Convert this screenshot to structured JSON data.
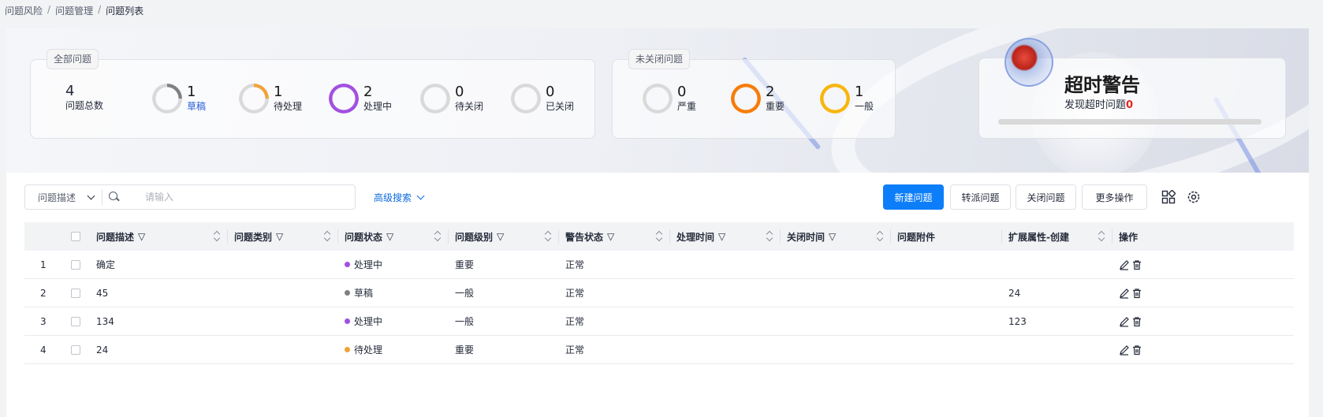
{
  "breadcrumb": [
    "问题风险",
    "问题管理",
    "问题列表"
  ],
  "all_issues": {
    "tag": "全部问题",
    "total": {
      "value": "4",
      "label": "问题总数"
    },
    "stats": [
      {
        "value": "1",
        "label": "草稿",
        "color": "#808080",
        "fraction": 0.25
      },
      {
        "value": "1",
        "label": "待处理",
        "color": "#f2a13a",
        "fraction": 0.25
      },
      {
        "value": "2",
        "label": "处理中",
        "color": "#a14fe0",
        "fraction": 1
      },
      {
        "value": "0",
        "label": "待关闭",
        "color": "#d9d9d9",
        "fraction": 0
      },
      {
        "value": "0",
        "label": "已关闭",
        "color": "#d9d9d9",
        "fraction": 0
      }
    ]
  },
  "open_issues": {
    "tag": "未关闭问题",
    "stats": [
      {
        "value": "0",
        "label": "严重",
        "color": "#d9d9d9",
        "fraction": 0
      },
      {
        "value": "2",
        "label": "重要",
        "color": "#f77b08",
        "fraction": 1
      },
      {
        "value": "1",
        "label": "一般",
        "color": "#f7b60e",
        "fraction": 1
      }
    ]
  },
  "alert": {
    "title": "超时警告",
    "sub_label": "发现超时问题",
    "count": "0"
  },
  "search": {
    "field": "问题描述",
    "placeholder": "请输入",
    "advanced": "高级搜索"
  },
  "buttons": {
    "new": "新建问题",
    "transfer": "转派问题",
    "close": "关闭问题",
    "more": "更多操作"
  },
  "table": {
    "columns": [
      "问题描述",
      "问题类别",
      "问题状态",
      "问题级别",
      "警告状态",
      "处理时间",
      "关闭时间",
      "问题附件",
      "扩展属性-创建",
      "操作"
    ],
    "rows": [
      {
        "index": "1",
        "desc": "确定",
        "category": "",
        "status": "处理中",
        "status_color": "#a14fe0",
        "level": "重要",
        "warn": "正常",
        "handle_time": "",
        "close_time": "",
        "attach": "",
        "ext": ""
      },
      {
        "index": "2",
        "desc": "45",
        "category": "",
        "status": "草稿",
        "status_color": "#808080",
        "level": "一般",
        "warn": "正常",
        "handle_time": "",
        "close_time": "",
        "attach": "",
        "ext": "24"
      },
      {
        "index": "3",
        "desc": "134",
        "category": "",
        "status": "处理中",
        "status_color": "#a14fe0",
        "level": "一般",
        "warn": "正常",
        "handle_time": "",
        "close_time": "",
        "attach": "",
        "ext": "123"
      },
      {
        "index": "4",
        "desc": "24",
        "category": "",
        "status": "待处理",
        "status_color": "#f2a13a",
        "level": "重要",
        "warn": "正常",
        "handle_time": "",
        "close_time": "",
        "attach": "",
        "ext": ""
      }
    ]
  }
}
